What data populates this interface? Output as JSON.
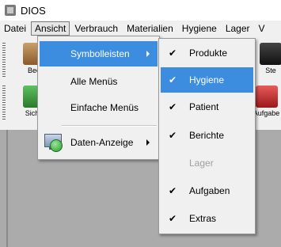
{
  "window": {
    "title": "DIOS",
    "icon": "dios-app-icon"
  },
  "menubar": {
    "items": [
      {
        "label": "Datei",
        "open": false
      },
      {
        "label": "Ansicht",
        "open": true
      },
      {
        "label": "Verbrauch",
        "open": false
      },
      {
        "label": "Materialien",
        "open": false
      },
      {
        "label": "Hygiene",
        "open": false
      },
      {
        "label": "Lager",
        "open": false
      },
      {
        "label": "V",
        "open": false
      }
    ]
  },
  "toolbar": {
    "row1": [
      {
        "label": "Bee",
        "icon": "box-icon",
        "color": "#8a5a2b"
      },
      {
        "label": "Ste",
        "icon": "checkmark-icon",
        "color": "#111111"
      }
    ],
    "row2": [
      {
        "label": "Siche",
        "icon": "backup-icon",
        "color": "#2a7a2a"
      },
      {
        "label": "Aufgabe",
        "icon": "tasks-icon",
        "color": "#9a1a1a"
      }
    ]
  },
  "ansicht_menu": {
    "items": [
      {
        "label": "Symbolleisten",
        "has_submenu": true,
        "highlighted": true
      },
      {
        "label": "Alle Menüs",
        "has_submenu": false,
        "highlighted": false
      },
      {
        "label": "Einfache Menüs",
        "has_submenu": false,
        "highlighted": false
      },
      {
        "label": "Daten-Anzeige",
        "has_submenu": true,
        "highlighted": false,
        "icon": "data-display-icon"
      }
    ]
  },
  "symbolleisten_submenu": {
    "items": [
      {
        "label": "Produkte",
        "checked": true,
        "enabled": true,
        "highlighted": false
      },
      {
        "label": "Hygiene",
        "checked": true,
        "enabled": true,
        "highlighted": true
      },
      {
        "label": "Patient",
        "checked": true,
        "enabled": true,
        "highlighted": false
      },
      {
        "label": "Berichte",
        "checked": true,
        "enabled": true,
        "highlighted": false
      },
      {
        "label": "Lager",
        "checked": false,
        "enabled": false,
        "highlighted": false
      },
      {
        "label": "Aufgaben",
        "checked": true,
        "enabled": true,
        "highlighted": false
      },
      {
        "label": "Extras",
        "checked": true,
        "enabled": true,
        "highlighted": false
      }
    ],
    "check_glyph": "✔"
  },
  "colors": {
    "highlight": "#3c8de0",
    "menu_bg": "#f0f0f0",
    "workspace_bg": "#ababab"
  }
}
